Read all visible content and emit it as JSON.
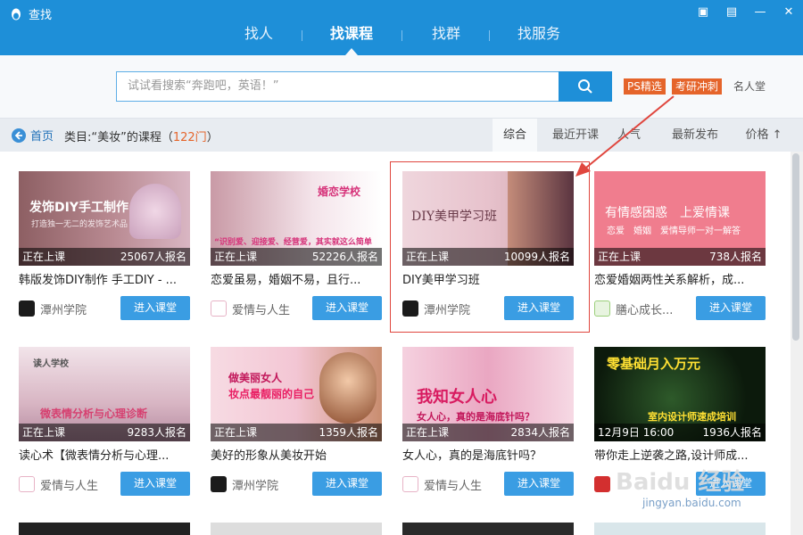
{
  "window": {
    "title": "查找"
  },
  "nav": {
    "tabs": [
      "找人",
      "找课程",
      "找群",
      "找服务"
    ],
    "active": 1
  },
  "search": {
    "placeholder": "试试看搜索“奔跑吧，英语！”"
  },
  "tags": {
    "ps": "PS精选",
    "kaoyan": "考研冲刺",
    "plain": "名人堂"
  },
  "filter": {
    "home": "首页",
    "crumb_prefix": "类目:“美妆”的课程（",
    "count": "122门",
    "crumb_suffix": "）",
    "sorts": [
      "综合",
      "最近开课",
      "人气",
      "最新发布",
      "价格 ↑"
    ]
  },
  "courses": [
    {
      "thumb_title": "发饰DIY手工制作",
      "thumb_sub": "打造独一无二的发饰艺术品",
      "status": "正在上课",
      "signups": "25067人报名",
      "title": "韩版发饰DIY制作 手工DIY - ...",
      "school": "潭州学院",
      "button": "进入课堂"
    },
    {
      "thumb_title": "婚恋学校",
      "thumb_sub": "“识别爱、迎接爱、经营爱，其实就这么简单",
      "status": "正在上课",
      "signups": "52226人报名",
      "title": "恋爱虽易，婚姻不易，且行...",
      "school": "爱情与人生",
      "button": "进入课堂"
    },
    {
      "thumb_title": "DIY美甲学习班",
      "thumb_sub": "",
      "status": "正在上课",
      "signups": "10099人报名",
      "title": "DIY美甲学习班",
      "school": "潭州学院",
      "button": "进入课堂"
    },
    {
      "thumb_title": "有情感困惑　上爱情课",
      "thumb_sub": "恋爱　婚姻　爱情导师一对一解答",
      "status": "正在上课",
      "signups": "738人报名",
      "title": "恋爱婚姻两性关系解析，成...",
      "school": "膳心成长...",
      "button": "进入课堂"
    },
    {
      "thumb_title": "读人学校",
      "thumb_sub": "微表情分析与心理诊断",
      "status": "正在上课",
      "signups": "9283人报名",
      "title": "读心术【微表情分析与心理...",
      "school": "爱情与人生",
      "button": "进入课堂"
    },
    {
      "thumb_title": "做美丽女人",
      "thumb_sub": "妆点最靓丽的自己",
      "status": "正在上课",
      "signups": "1359人报名",
      "title": "美好的形象从美妆开始",
      "school": "潭州学院",
      "button": "进入课堂"
    },
    {
      "thumb_title": "我知女人心",
      "thumb_sub": "女人心，真的是海底针吗？",
      "status": "正在上课",
      "signups": "2834人报名",
      "title": "女人心，真的是海底针吗？",
      "school": "爱情与人生",
      "button": "进入课堂"
    },
    {
      "thumb_title": "零基础月入万元",
      "thumb_sub": "室内设计师速成培训",
      "status": "12月9日 16:00",
      "signups": "1936人报名",
      "title": "带你走上逆袭之路,设计师成...",
      "school": "",
      "button": "进入课堂"
    }
  ],
  "watermark": {
    "main": "Baidu 经验",
    "sub": "jingyan.baidu.com"
  },
  "colors": {
    "brand": "#1e8fd8",
    "tag": "#e5642a",
    "button": "#3a9de3",
    "highlight": "#e0463e"
  }
}
